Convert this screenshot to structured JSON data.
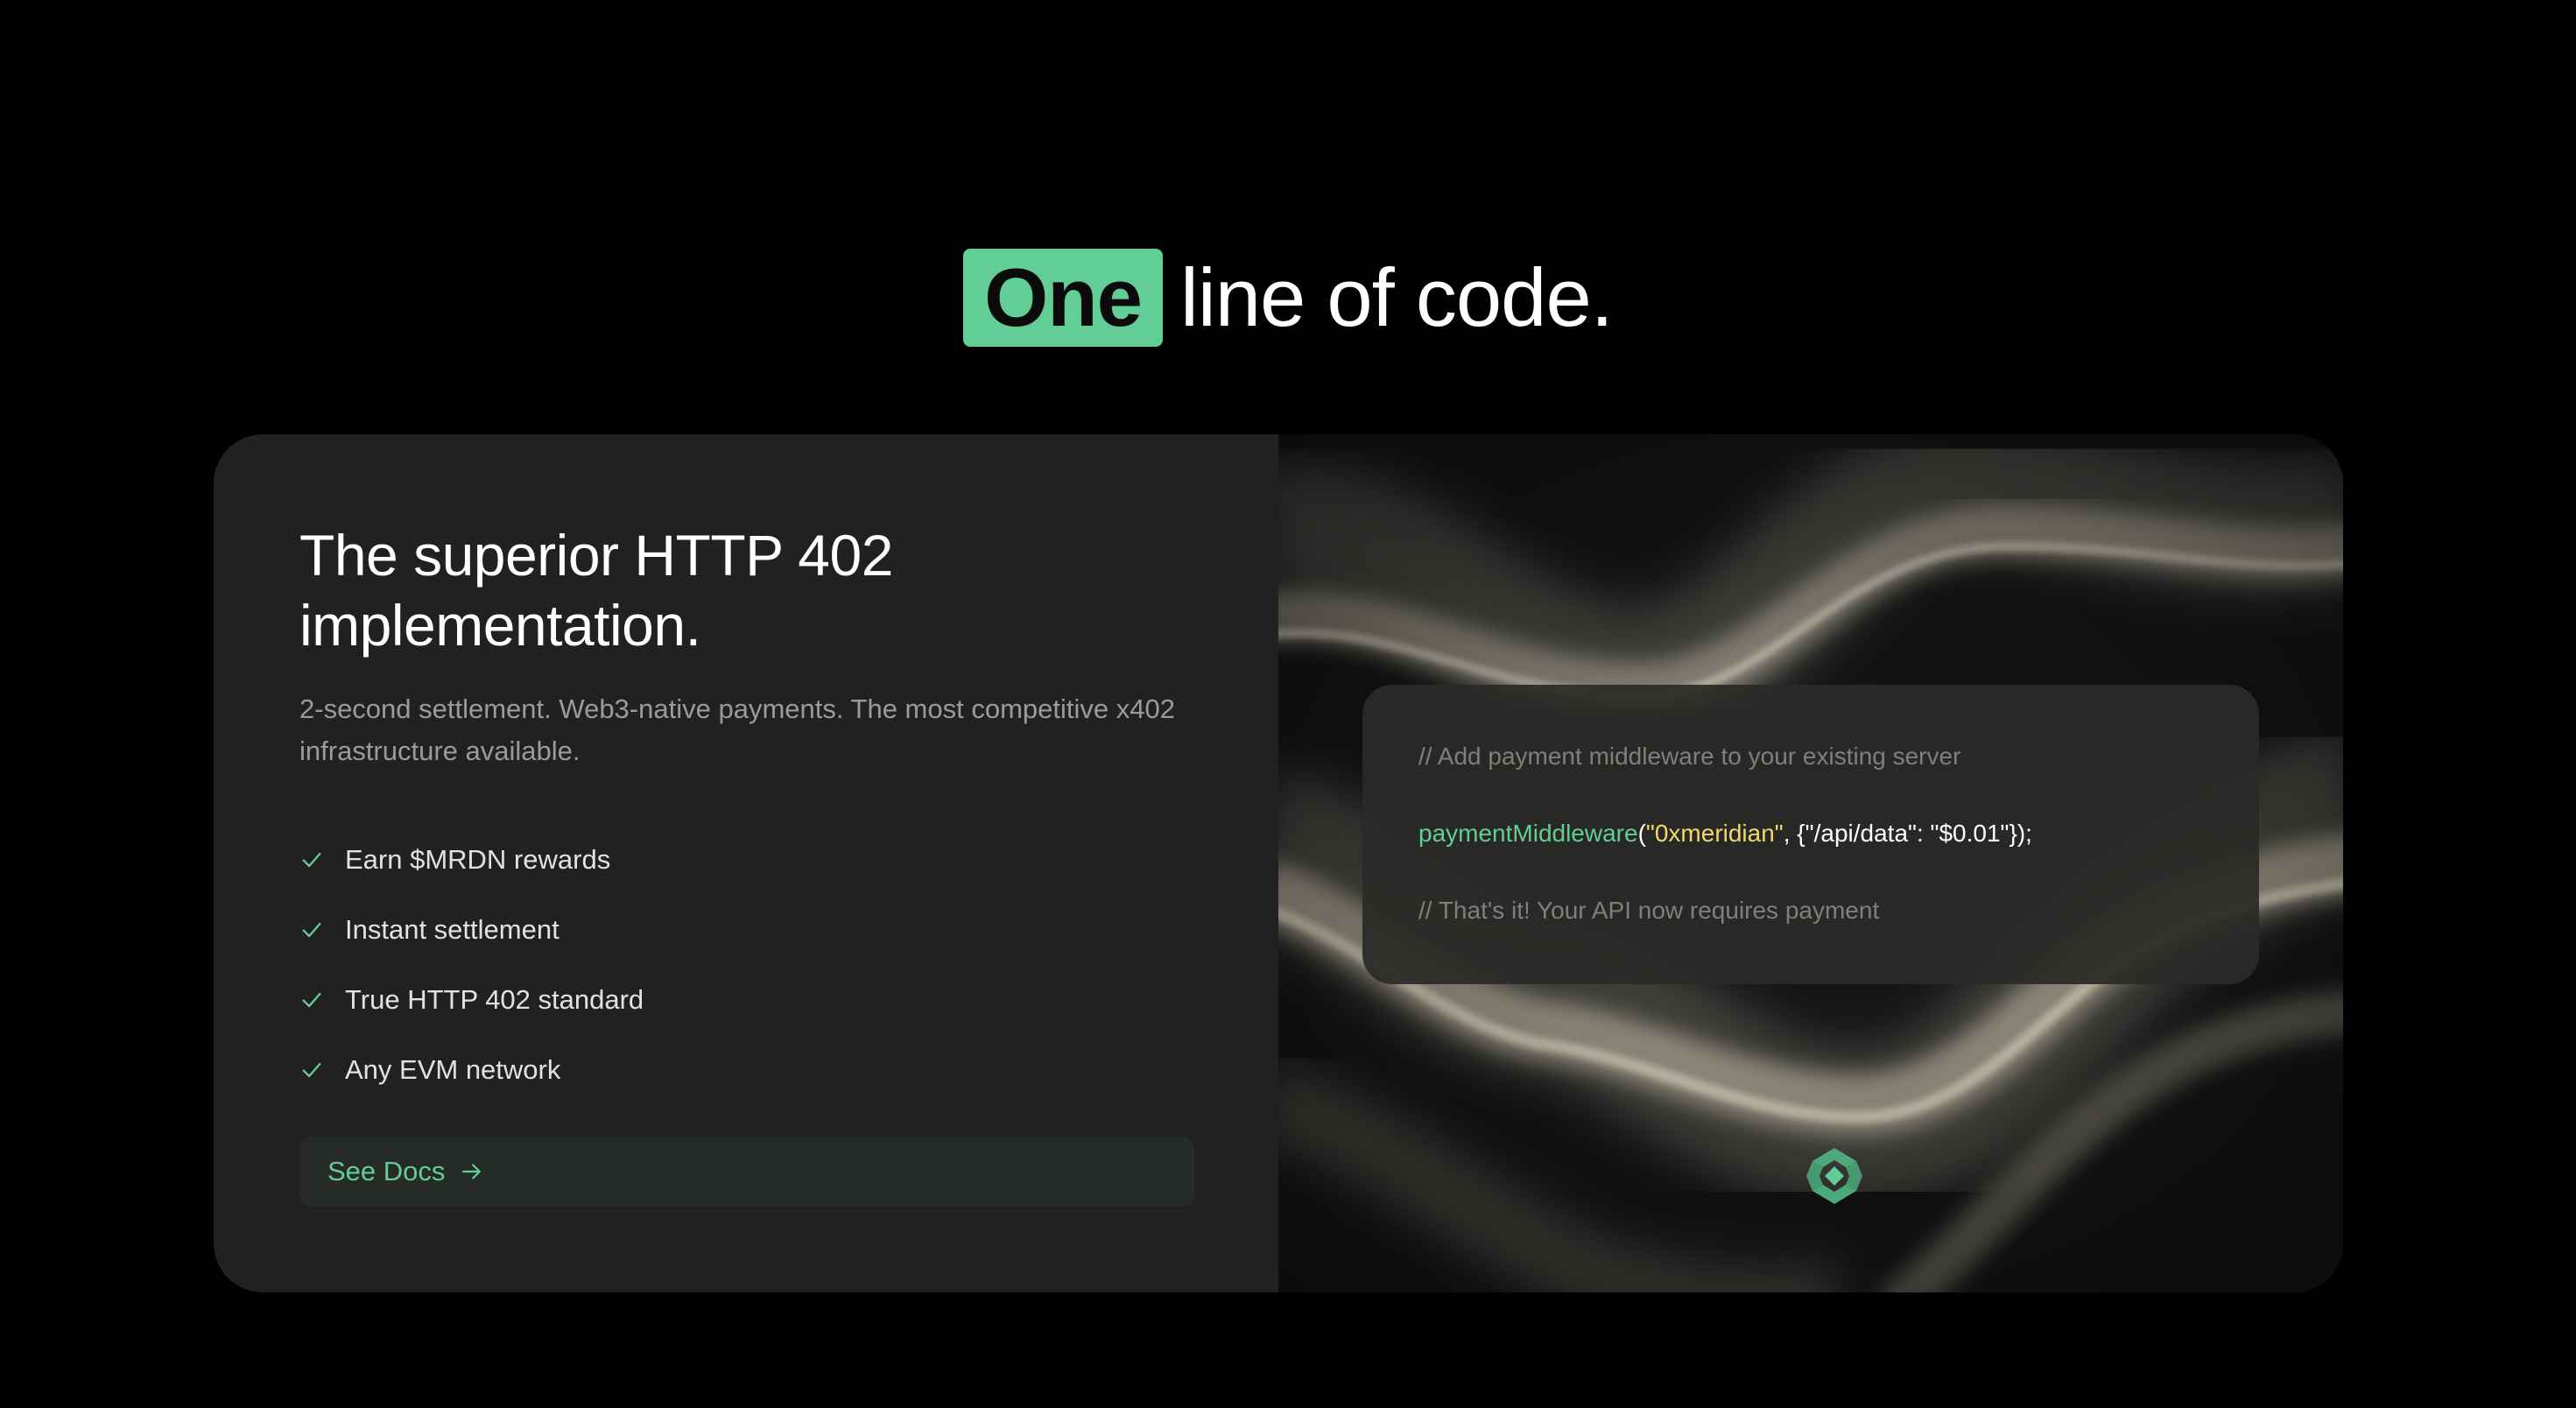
{
  "headline": {
    "highlight": "One",
    "rest": "line of code."
  },
  "card": {
    "title": "The superior HTTP 402 implementation.",
    "subtitle": "2-second settlement. Web3-native payments. The most competitive x402 infrastructure available.",
    "features": [
      {
        "label": "Earn $MRDN rewards",
        "icon": "check-icon"
      },
      {
        "label": "Instant settlement",
        "icon": "check-icon"
      },
      {
        "label": "True HTTP 402 standard",
        "icon": "check-icon"
      },
      {
        "label": "Any EVM network",
        "icon": "check-icon"
      }
    ],
    "docs_button": {
      "label": "See Docs",
      "icon": "arrow-right-icon"
    }
  },
  "code": {
    "comment_top": "// Add payment middleware to your existing server",
    "fn_name": "paymentMiddleware",
    "open_paren": "(",
    "address": "\"0xmeridian\"",
    "args_rest": ", {\"/api/data\": \"$0.01\"});",
    "comment_bottom": "// That's it! Your API now requires payment"
  },
  "colors": {
    "accent": "#63cd96",
    "background": "#000000",
    "card": "#212121",
    "string": "#f3d86c",
    "comment": "#7f7f7b"
  },
  "logo_icon": "meridian-logo-icon"
}
